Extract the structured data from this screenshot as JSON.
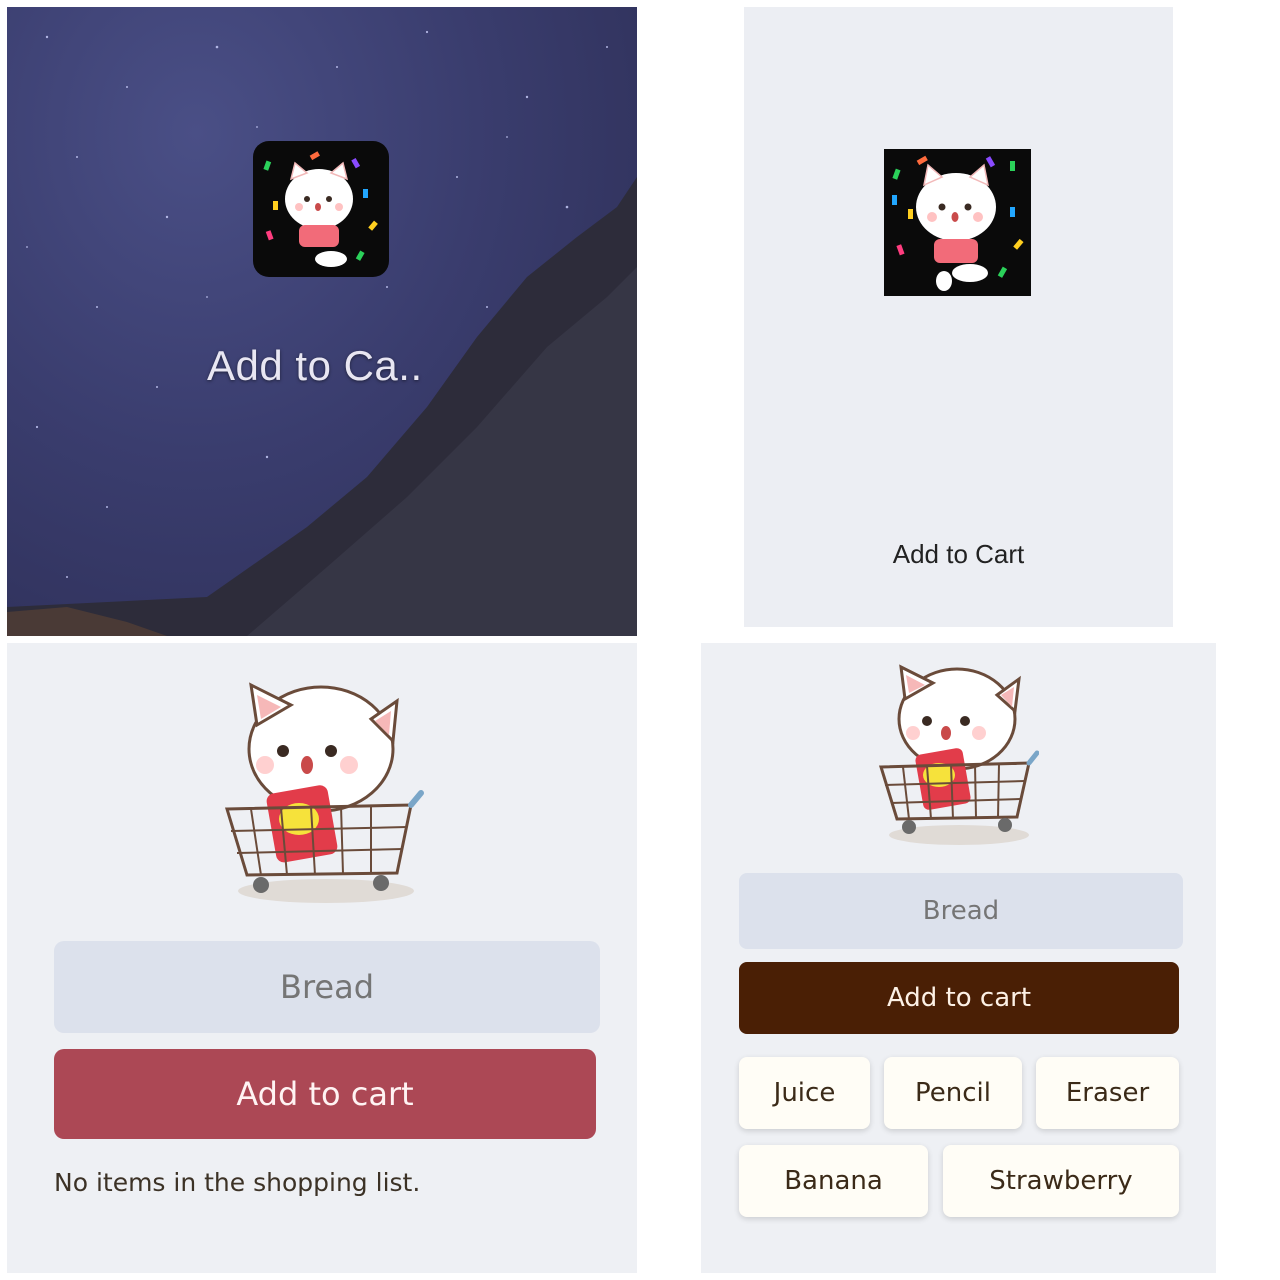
{
  "home_screen": {
    "app_label": "Add to Ca.."
  },
  "splash_screen": {
    "title": "Add to Cart"
  },
  "empty_screen": {
    "input_placeholder": "Bread",
    "button_label": "Add to cart",
    "empty_message": "No items in the shopping list."
  },
  "list_screen": {
    "input_placeholder": "Bread",
    "button_label": "Add to cart",
    "items": [
      "Juice",
      "Pencil",
      "Eraser",
      "Banana",
      "Strawberry"
    ]
  },
  "colors": {
    "button_red": "#ac4855",
    "button_brown": "#4a1f05",
    "input_bg": "#dce1ec",
    "page_bg": "#eef0f4",
    "chip_bg": "#fffdf6"
  }
}
